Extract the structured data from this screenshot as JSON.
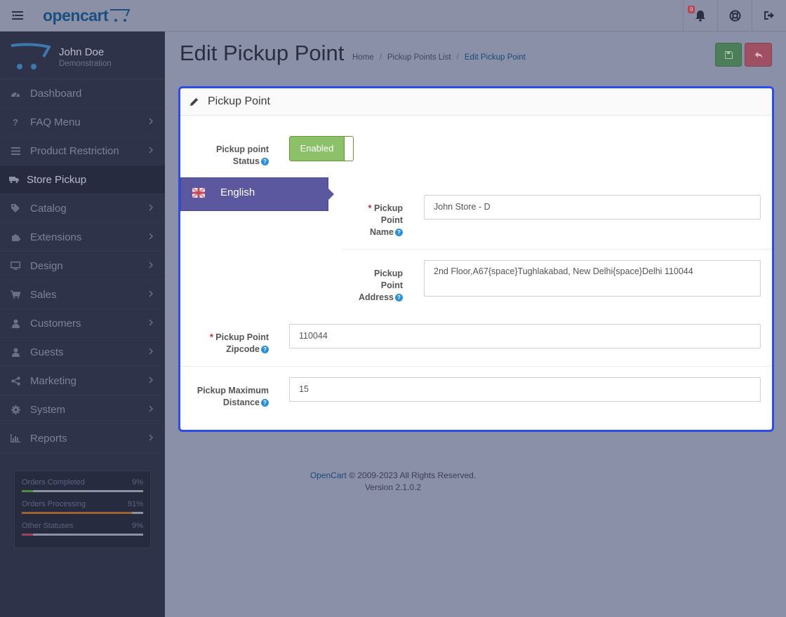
{
  "header": {
    "logo_text": "opencart",
    "notification_count": "9"
  },
  "sidebar": {
    "user_name": "John Doe",
    "user_role": "Demonstration",
    "items": [
      {
        "label": "Dashboard",
        "icon": "dashboard-icon"
      },
      {
        "label": "FAQ Menu",
        "icon": "question-icon"
      },
      {
        "label": "Product Restriction",
        "icon": "list-icon"
      },
      {
        "label": "Store Pickup",
        "icon": "truck-icon"
      },
      {
        "label": "Catalog",
        "icon": "tag-icon"
      },
      {
        "label": "Extensions",
        "icon": "puzzle-icon"
      },
      {
        "label": "Design",
        "icon": "monitor-icon"
      },
      {
        "label": "Sales",
        "icon": "cart-icon"
      },
      {
        "label": "Customers",
        "icon": "user-icon"
      },
      {
        "label": "Guests",
        "icon": "user-icon"
      },
      {
        "label": "Marketing",
        "icon": "share-icon"
      },
      {
        "label": "System",
        "icon": "gear-icon"
      },
      {
        "label": "Reports",
        "icon": "bar-chart-icon"
      }
    ],
    "stats": [
      {
        "label": "Orders Completed",
        "value": "9%",
        "fraction": 0.09,
        "color": "#4f8c3e"
      },
      {
        "label": "Orders Processing",
        "value": "91%",
        "fraction": 0.91,
        "color": "#a0602f"
      },
      {
        "label": "Other Statuses",
        "value": "9%",
        "fraction": 0.09,
        "color": "#a04258"
      }
    ]
  },
  "page": {
    "title": "Edit Pickup Point",
    "breadcrumb": [
      "Home",
      "Pickup Points List",
      "Edit Pickup Point"
    ]
  },
  "panel": {
    "title": "Pickup Point",
    "status_label_1": "Pickup point",
    "status_label_2": "Status",
    "status_value": "Enabled",
    "language_tab": "English",
    "name_label_1": "Pickup",
    "name_label_2": "Point",
    "name_label_3": "Name",
    "name_value": "John Store - D",
    "address_label_1": "Pickup",
    "address_label_2": "Point",
    "address_label_3": "Address",
    "address_value": "2nd Floor,A67{space}Tughlakabad, New Delhi{space}Delhi 110044",
    "zipcode_label_1": "Pickup Point",
    "zipcode_label_2": "Zipcode",
    "zipcode_value": "110044",
    "distance_label_1": "Pickup Maximum",
    "distance_label_2": "Distance",
    "distance_value": "15"
  },
  "footer": {
    "link": "OpenCart",
    "copyright": "© 2009-2023 All Rights Reserved.",
    "version": "Version 2.1.0.2"
  },
  "colors": {
    "panel_border": "#2f4be6",
    "language_tab": "#5b58a0",
    "toggle_enabled": "#8cc16a"
  }
}
